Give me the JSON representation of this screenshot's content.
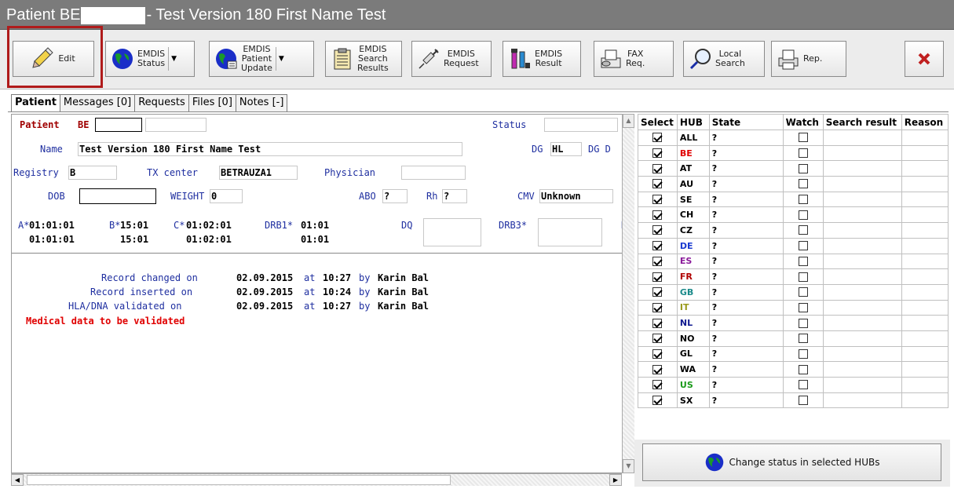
{
  "window": {
    "title_prefix": "Patient  BE",
    "title_suffix": "- Test Version 180 First Name Test"
  },
  "toolbar": {
    "edit": "Edit",
    "emdis_status": "EMDIS\nStatus",
    "emdis_patient_update": "EMDIS\nPatient\nUpdate",
    "emdis_search_results": "EMDIS\nSearch\nResults",
    "emdis_request": "EMDIS\nRequest",
    "emdis_result": "EMDIS\nResult",
    "fax_req": "FAX\nReq.",
    "local_search": "Local\nSearch",
    "rep": "Rep."
  },
  "tabs": [
    "Patient",
    "Messages [0]",
    "Requests",
    "Files [0]",
    "Notes [-]"
  ],
  "patient": {
    "patient_label": "Patient",
    "patient_value": "BE",
    "status_label": "Status",
    "name_label": "Name",
    "name_value": "Test Version 180 First Name Test",
    "dg_label": "DG",
    "dg_value": "HL",
    "dg_d_label": "DG D",
    "registry_label": "Registry",
    "registry_value": "B",
    "tx_center_label": "TX center",
    "tx_center_value": "BETRAUZA1",
    "physician_label": "Physician",
    "dob_label": "DOB",
    "weight_label": "WEIGHT",
    "weight_value": "0",
    "abo_label": "ABO",
    "abo_value": "?",
    "rh_label": "Rh",
    "rh_value": "?",
    "cmv_label": "CMV",
    "cmv_value": "Unknown"
  },
  "hla": {
    "a_label": "A*",
    "a1": "01:01:01",
    "a2": "01:01:01",
    "b_label": "B*",
    "b1": "15:01",
    "b2": "15:01",
    "c_label": "C*",
    "c1": "01:02:01",
    "c2": "01:02:01",
    "drb1_label": "DRB1*",
    "drb1_1": "01:01",
    "drb1_2": "01:01",
    "dq_label": "DQ",
    "drb3_label": "DRB3*",
    "d_label": "D"
  },
  "record": {
    "changed_label": "Record changed on",
    "changed_date": "02.09.2015",
    "changed_at": "at",
    "changed_time": "10:27",
    "changed_by": "by",
    "changed_user": "Karin Bal",
    "inserted_label": "Record inserted on",
    "inserted_date": "02.09.2015",
    "inserted_at": "at",
    "inserted_time": "10:24",
    "inserted_by": "by",
    "inserted_user": "Karin Bal",
    "validated_label": "HLA/DNA validated on",
    "validated_date": "02.09.2015",
    "validated_at": "at",
    "validated_time": "10:27",
    "validated_by": "by",
    "validated_user": "Karin Bal",
    "warning": "Medical data to be validated"
  },
  "hubs": {
    "headers": [
      "Select",
      "HUB",
      "State",
      "Watch",
      "Search result",
      "Reason"
    ],
    "rows": [
      {
        "hub": "ALL",
        "state": "?",
        "color": "#000000"
      },
      {
        "hub": "BE",
        "state": "?",
        "color": "#e00000"
      },
      {
        "hub": "AT",
        "state": "?",
        "color": "#000000"
      },
      {
        "hub": "AU",
        "state": "?",
        "color": "#000000"
      },
      {
        "hub": "SE",
        "state": "?",
        "color": "#000000"
      },
      {
        "hub": "CH",
        "state": "?",
        "color": "#000000"
      },
      {
        "hub": "CZ",
        "state": "?",
        "color": "#000000"
      },
      {
        "hub": "DE",
        "state": "?",
        "color": "#1a3ad0"
      },
      {
        "hub": "ES",
        "state": "?",
        "color": "#8a1a9a"
      },
      {
        "hub": "FR",
        "state": "?",
        "color": "#b00000"
      },
      {
        "hub": "GB",
        "state": "?",
        "color": "#1a8a8a"
      },
      {
        "hub": "IT",
        "state": "?",
        "color": "#9a9a1a"
      },
      {
        "hub": "NL",
        "state": "?",
        "color": "#101a90"
      },
      {
        "hub": "NO",
        "state": "?",
        "color": "#000000"
      },
      {
        "hub": "GL",
        "state": "?",
        "color": "#000000"
      },
      {
        "hub": "WA",
        "state": "?",
        "color": "#000000"
      },
      {
        "hub": "US",
        "state": "?",
        "color": "#1a9a1a"
      },
      {
        "hub": "SX",
        "state": "?",
        "color": "#000000"
      }
    ],
    "change_status_button": "Change status in selected HUBs"
  }
}
